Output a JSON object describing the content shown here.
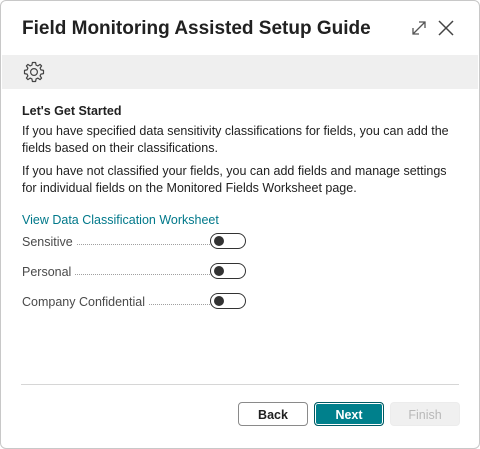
{
  "dialog": {
    "title": "Field Monitoring Assisted Setup Guide"
  },
  "icons": {
    "expand": "expand-icon",
    "close": "close-icon",
    "settings": "gear-icon"
  },
  "content": {
    "heading": "Let's Get Started",
    "paragraph1": "If you have specified data sensitivity classifications for fields, you can add the fields based on their classifications.",
    "paragraph2": "If you have not classified your fields, you can add fields and manage settings for individual fields on the Monitored Fields Worksheet page.",
    "link": "View Data Classification Worksheet"
  },
  "fields": [
    {
      "label": "Sensitive",
      "enabled": false
    },
    {
      "label": "Personal",
      "enabled": false
    },
    {
      "label": "Company Confidential",
      "enabled": false
    }
  ],
  "footer": {
    "back_label": "Back",
    "next_label": "Next",
    "finish_label": "Finish"
  },
  "colors": {
    "accent": "#00808c",
    "link": "#00788a",
    "toolbar_bg": "#efefef"
  }
}
